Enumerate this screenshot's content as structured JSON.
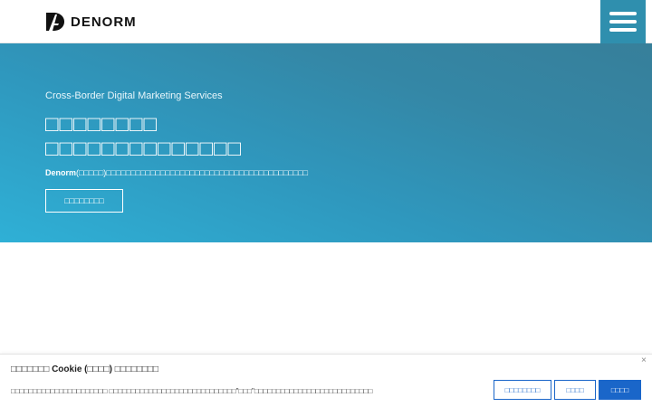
{
  "header": {
    "brand": "DENORM",
    "menu_icon": "hamburger-menu-icon",
    "accent_color": "#2f8fae"
  },
  "hero": {
    "subtitle": "Cross-Border Digital Marketing Services",
    "title_line1": "□□□□□□□□",
    "title_line2": "□□□□□□□□□□□□□□",
    "desc_brand": "Denorm",
    "desc_rest": "(□□□□□)□□□□□□□□□□□□□□□□□□□□□□□□□□□□□□□□□□□□□□□□□",
    "button_label": "□□□□□□□□"
  },
  "cookie": {
    "title_prefix": "□□□□□□□",
    "title_main": "Cookie (□□□□) □□□□□□□□",
    "text": "□□□□□□□□□□□□□□□□□□□□□□ □□□□□□□□□□□□□□□□□□□□□□□□□□□□□\"□□□\"□□□□□□□□□□□□□□□□□□□□□□□□□□□",
    "customize_label": "□□□□□□□□",
    "reject_label": "□□□□",
    "accept_label": "□□□□",
    "close_icon": "close-icon",
    "button_color": "#1a66c9"
  }
}
